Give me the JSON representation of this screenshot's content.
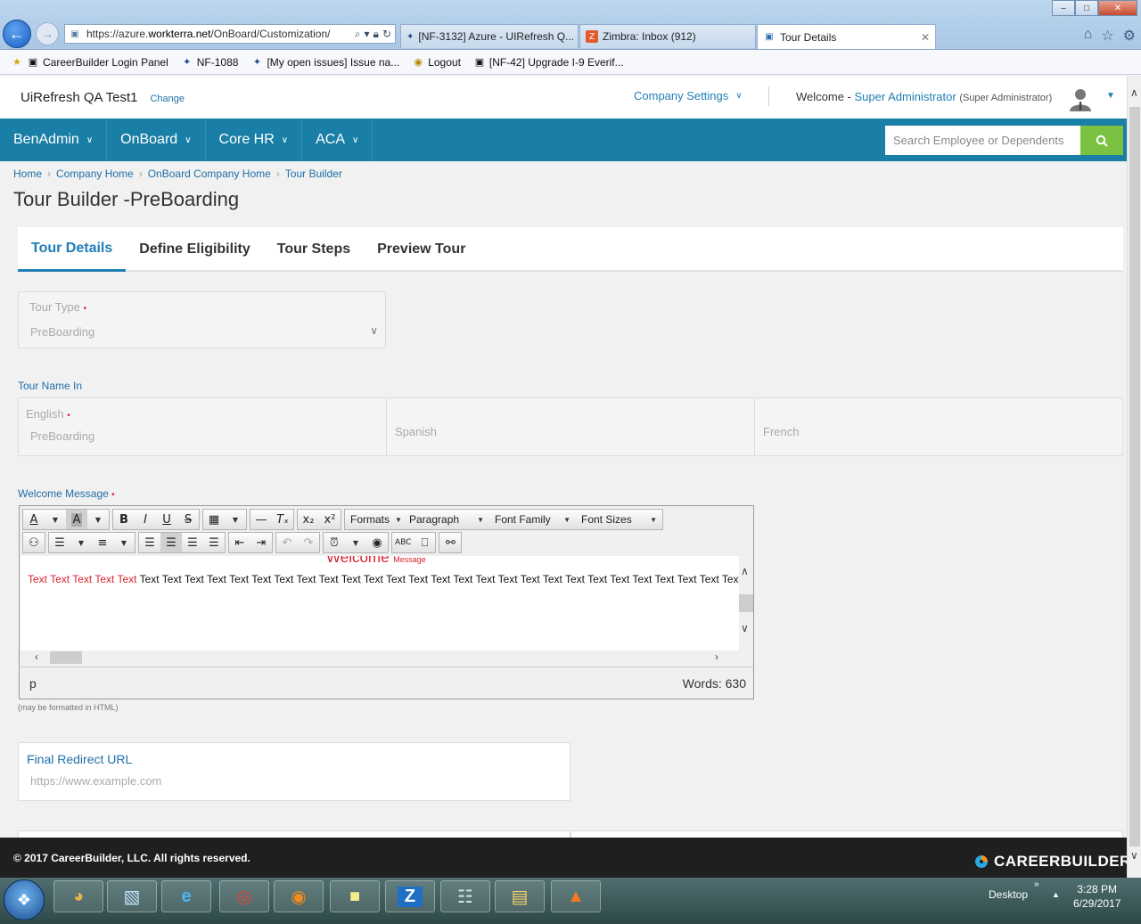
{
  "browser": {
    "url_prefix": "https://azure.",
    "url_domain": "workterra.net",
    "url_path": "/OnBoard/Customization/",
    "tabs": [
      {
        "label": "[NF-3132] Azure - UIRefresh Q..."
      },
      {
        "label": "Zimbra: Inbox (912)"
      },
      {
        "label": "Tour Details"
      }
    ],
    "favorites": [
      {
        "label": "CareerBuilder Login Panel"
      },
      {
        "label": "NF-1088"
      },
      {
        "label": "[My open issues] Issue na..."
      },
      {
        "label": "Logout"
      },
      {
        "label": "[NF-42] Upgrade I-9 Everif..."
      }
    ]
  },
  "header": {
    "company": "UiRefresh QA Test1",
    "change": "Change",
    "company_settings": "Company Settings",
    "welcome": "Welcome -",
    "user": "Super Administrator",
    "role": "(Super Administrator)"
  },
  "nav": {
    "items": [
      {
        "label": "BenAdmin"
      },
      {
        "label": "OnBoard"
      },
      {
        "label": "Core HR"
      },
      {
        "label": "ACA"
      }
    ],
    "search_placeholder": "Search Employee or Dependents"
  },
  "breadcrumb": [
    "Home",
    "Company Home",
    "OnBoard Company Home",
    "Tour Builder"
  ],
  "page_title": "Tour Builder -PreBoarding",
  "tabs": [
    {
      "label": "Tour Details"
    },
    {
      "label": "Define Eligibility"
    },
    {
      "label": "Tour Steps"
    },
    {
      "label": "Preview Tour"
    }
  ],
  "form": {
    "tour_type_label": "Tour Type",
    "tour_type_value": "PreBoarding",
    "tour_name_label": "Tour Name In",
    "english_label": "English",
    "english_value": "PreBoarding",
    "spanish_placeholder": "Spanish",
    "french_placeholder": "French",
    "welcome_label": "Welcome Message",
    "hint": "(may be formatted in HTML)",
    "redirect_label": "Final Redirect URL",
    "redirect_placeholder": "https://www.example.com"
  },
  "editor": {
    "formats": "Formats",
    "paragraph": "Paragraph",
    "font_family": "Font Family",
    "font_sizes": "Font Sizes",
    "heading_big": "Welcome",
    "heading_small": "Message",
    "text_red": "Text Text Text Text Text",
    "text_black": " Text Text Text Text Text Text Text Text Text Text Text Text Text Text Text Text Text Text Text Text Text Text Text Text Text Text Text T",
    "path": "p",
    "word_count": "Words: 630"
  },
  "footer": {
    "copyright": "© 2017 CareerBuilder, LLC. All rights reserved.",
    "logo": "CAREERBUILDER"
  },
  "taskbar": {
    "desktop": "Desktop",
    "time": "3:28 PM",
    "date": "6/29/2017"
  },
  "colors": {
    "nav_bg": "#1a7fa7",
    "accent": "#1f7eb5",
    "search_button": "#7cc242",
    "required": "#d9232e"
  }
}
